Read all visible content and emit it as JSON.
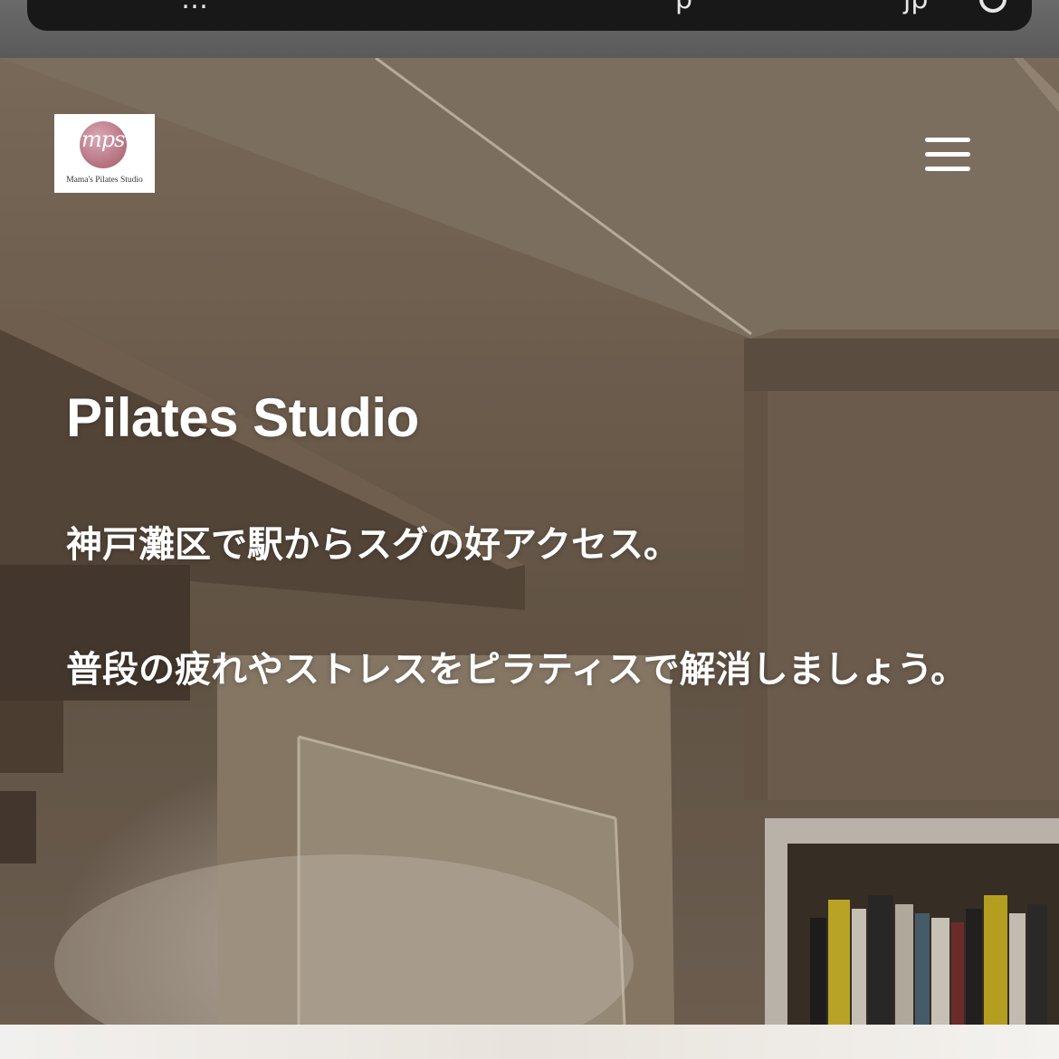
{
  "browser": {
    "url_fragment_left": "…",
    "url_fragment_right": "p",
    "url_fragment_end": "jp"
  },
  "header": {
    "logo_mark": "mps",
    "logo_text": "Mama's Pilates Studio"
  },
  "hero": {
    "title": "Pilates Studio",
    "line1": "神戸灘区で駅からスグの好アクセス。",
    "line2": "普段の疲れやストレスをピラティスで解消しましょう。"
  },
  "colors": {
    "text": "#ffffff",
    "logo_accent": "#b4707f"
  }
}
